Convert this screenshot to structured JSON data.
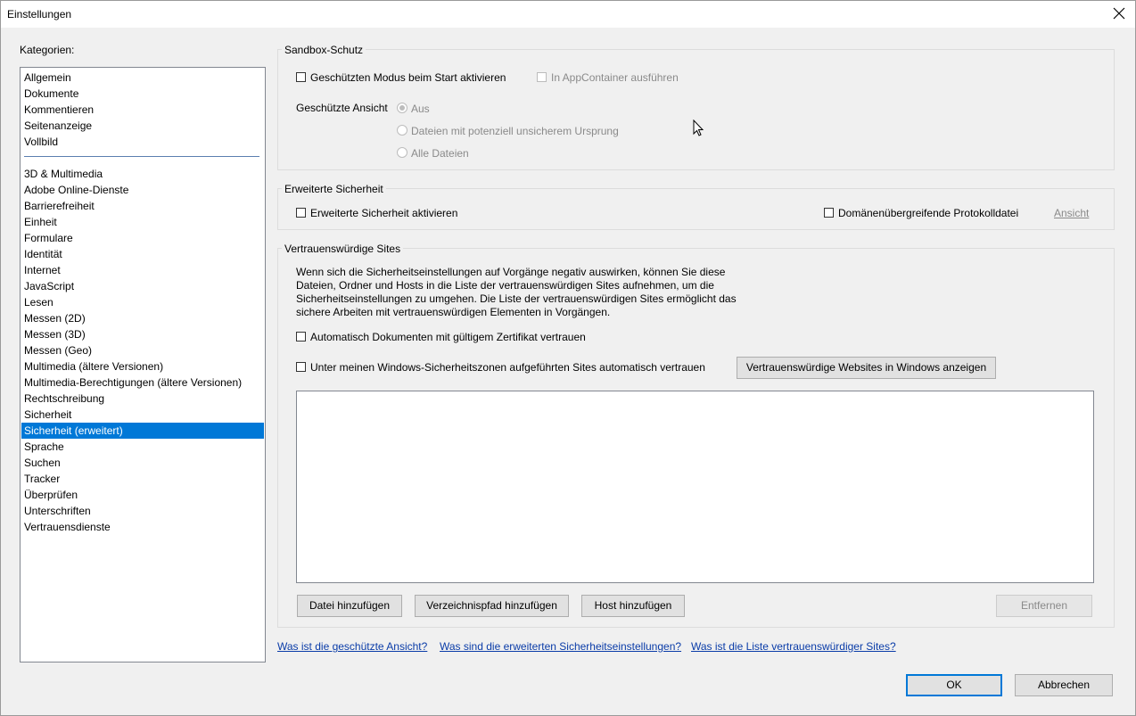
{
  "window": {
    "title": "Einstellungen"
  },
  "categories": {
    "label": "Kategorien:",
    "group1": [
      "Allgemein",
      "Dokumente",
      "Kommentieren",
      "Seitenanzeige",
      "Vollbild"
    ],
    "group2": [
      "3D & Multimedia",
      "Adobe Online-Dienste",
      "Barrierefreiheit",
      "Einheit",
      "Formulare",
      "Identität",
      "Internet",
      "JavaScript",
      "Lesen",
      "Messen (2D)",
      "Messen (3D)",
      "Messen (Geo)",
      "Multimedia (ältere Versionen)",
      "Multimedia-Berechtigungen (ältere Versionen)",
      "Rechtschreibung",
      "Sicherheit",
      "Sicherheit (erweitert)",
      "Sprache",
      "Suchen",
      "Tracker",
      "Überprüfen",
      "Unterschriften",
      "Vertrauensdienste"
    ],
    "selected": "Sicherheit (erweitert)"
  },
  "sandbox": {
    "title": "Sandbox-Schutz",
    "protected_mode_label": "Geschützten Modus beim Start aktivieren",
    "appcontainer_label": "In AppContainer ausführen",
    "protected_view_label": "Geschützte Ansicht",
    "radio_off": "Aus",
    "radio_unsafe": "Dateien mit potenziell unsicherem Ursprung",
    "radio_all": "Alle Dateien"
  },
  "enhanced": {
    "title": "Erweiterte Sicherheit",
    "enable_label": "Erweiterte Sicherheit aktivieren",
    "crossdomain_label": "Domänenübergreifende Protokolldatei",
    "view_label": "Ansicht"
  },
  "trusted": {
    "title": "Vertrauenswürdige Sites",
    "description": [
      "Wenn sich die Sicherheitseinstellungen auf Vorgänge negativ auswirken,  können Sie diese",
      "Dateien, Ordner und Hosts in die Liste der vertrauenswürdigen Sites aufnehmen, um die",
      "Sicherheitseinstellungen zu umgehen. Die Liste der vertrauenswürdigen Sites ermöglicht das",
      "sichere Arbeiten mit vertrauenswürdigen Elementen in Vorgängen."
    ],
    "cert_label": "Automatisch Dokumenten mit gültigem Zertifikat vertrauen",
    "windows_zones_label": "Unter meinen Windows-Sicherheitszonen aufgeführten Sites automatisch vertrauen",
    "show_windows_sites_button": "Vertrauenswürdige Websites in Windows anzeigen",
    "add_file_button": "Datei hinzufügen",
    "add_dir_button": "Verzeichnispfad hinzufügen",
    "add_host_button": "Host hinzufügen",
    "remove_button": "Entfernen"
  },
  "links": {
    "protected_view": "Was ist die geschützte Ansicht?",
    "enhanced_security": "Was sind die erweiterten Sicherheitseinstellungen?",
    "trusted_sites": "Was ist die Liste vertrauenswürdiger Sites?"
  },
  "footer": {
    "ok": "OK",
    "cancel": "Abbrechen"
  },
  "icons": {
    "close": "close-icon",
    "cursor": "mouse-cursor-icon"
  }
}
